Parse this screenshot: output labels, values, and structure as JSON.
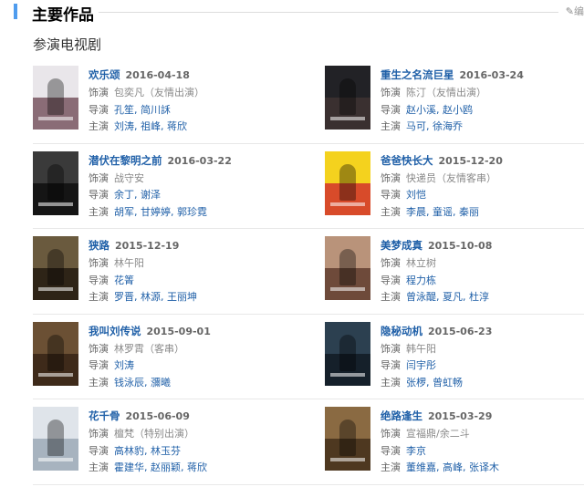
{
  "section": {
    "title": "主要作品",
    "edit_label": "编"
  },
  "subsection": {
    "title": "参演电视剧"
  },
  "labels": {
    "role": "饰演",
    "director": "导演",
    "cast": "主演"
  },
  "colors": {
    "accent": "#4f9cee",
    "link": "#2060a8"
  },
  "works": [
    {
      "title": "欢乐颂",
      "date": "2016-04-18",
      "role": "包奕凡（友情出演）",
      "director": "孔笙, 简川訸",
      "cast": "刘涛, 祖峰, 蒋欣",
      "poster_colors": [
        "#e9e6ea",
        "#8a6c76"
      ]
    },
    {
      "title": "重生之名流巨星",
      "date": "2016-03-24",
      "role": "陈汀（友情出演）",
      "director": "赵小溪, 赵小鸥",
      "cast": "马可, 徐海乔",
      "poster_colors": [
        "#222226",
        "#3a3030"
      ]
    },
    {
      "title": "潜伏在黎明之前",
      "date": "2016-03-22",
      "role": "战守安",
      "director": "余丁, 谢泽",
      "cast": "胡军, 甘婷婷, 郭珍霓",
      "poster_colors": [
        "#3a3a3a",
        "#151515"
      ]
    },
    {
      "title": "爸爸快长大",
      "date": "2015-12-20",
      "role": "快递员（友情客串）",
      "director": "刘恺",
      "cast": "李晨, 童谣, 秦丽",
      "poster_colors": [
        "#f4d21e",
        "#d84b2a"
      ]
    },
    {
      "title": "狭路",
      "date": "2015-12-19",
      "role": "林午阳",
      "director": "花箐",
      "cast": "罗晋, 林源, 王丽坤",
      "poster_colors": [
        "#6a5a3e",
        "#2e2417"
      ]
    },
    {
      "title": "美梦成真",
      "date": "2015-10-08",
      "role": "林立树",
      "director": "程力栋",
      "cast": "曾泳醍, 夏凡, 杜淳",
      "poster_colors": [
        "#b9937a",
        "#6e4a3a"
      ]
    },
    {
      "title": "我叫刘传说",
      "date": "2015-09-01",
      "role": "林罗霄（客串）",
      "director": "刘涛",
      "cast": "钱泳辰, 瀰曦",
      "poster_colors": [
        "#6b5034",
        "#3e2a1a"
      ]
    },
    {
      "title": "隐秘动机",
      "date": "2015-06-23",
      "role": "韩午阳",
      "director": "闫宇彤",
      "cast": "张椤, 曾虹畅",
      "poster_colors": [
        "#2c4050",
        "#15202a"
      ]
    },
    {
      "title": "花千骨",
      "date": "2015-06-09",
      "role": "檀梵（特别出演）",
      "director": "高林豹, 林玉芬",
      "cast": "霍建华, 赵丽颖, 蒋欣",
      "poster_colors": [
        "#dfe4ea",
        "#a7b3bf"
      ]
    },
    {
      "title": "绝路逢生",
      "date": "2015-03-29",
      "role": "宣福鼎/余二斗",
      "director": "李京",
      "cast": "董维嘉, 高峰, 张译木",
      "poster_colors": [
        "#8a6a42",
        "#4e3820"
      ]
    }
  ]
}
